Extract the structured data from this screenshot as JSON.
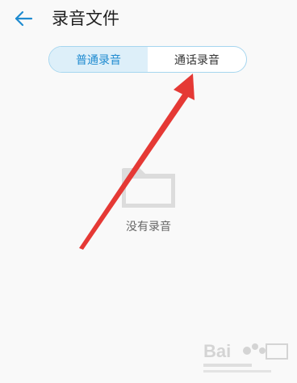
{
  "header": {
    "back_icon": "arrow-left-icon",
    "title": "录音文件"
  },
  "tabs": [
    {
      "label": "普通录音",
      "active": true
    },
    {
      "label": "通话录音",
      "active": false
    }
  ],
  "empty_state": {
    "icon": "folder-icon",
    "text": "没有录音"
  },
  "colors": {
    "accent": "#1f8bd0",
    "tab_active_bg": "#ddeff9",
    "tab_border": "#a6d6ef",
    "annotation_arrow": "#e53935"
  }
}
